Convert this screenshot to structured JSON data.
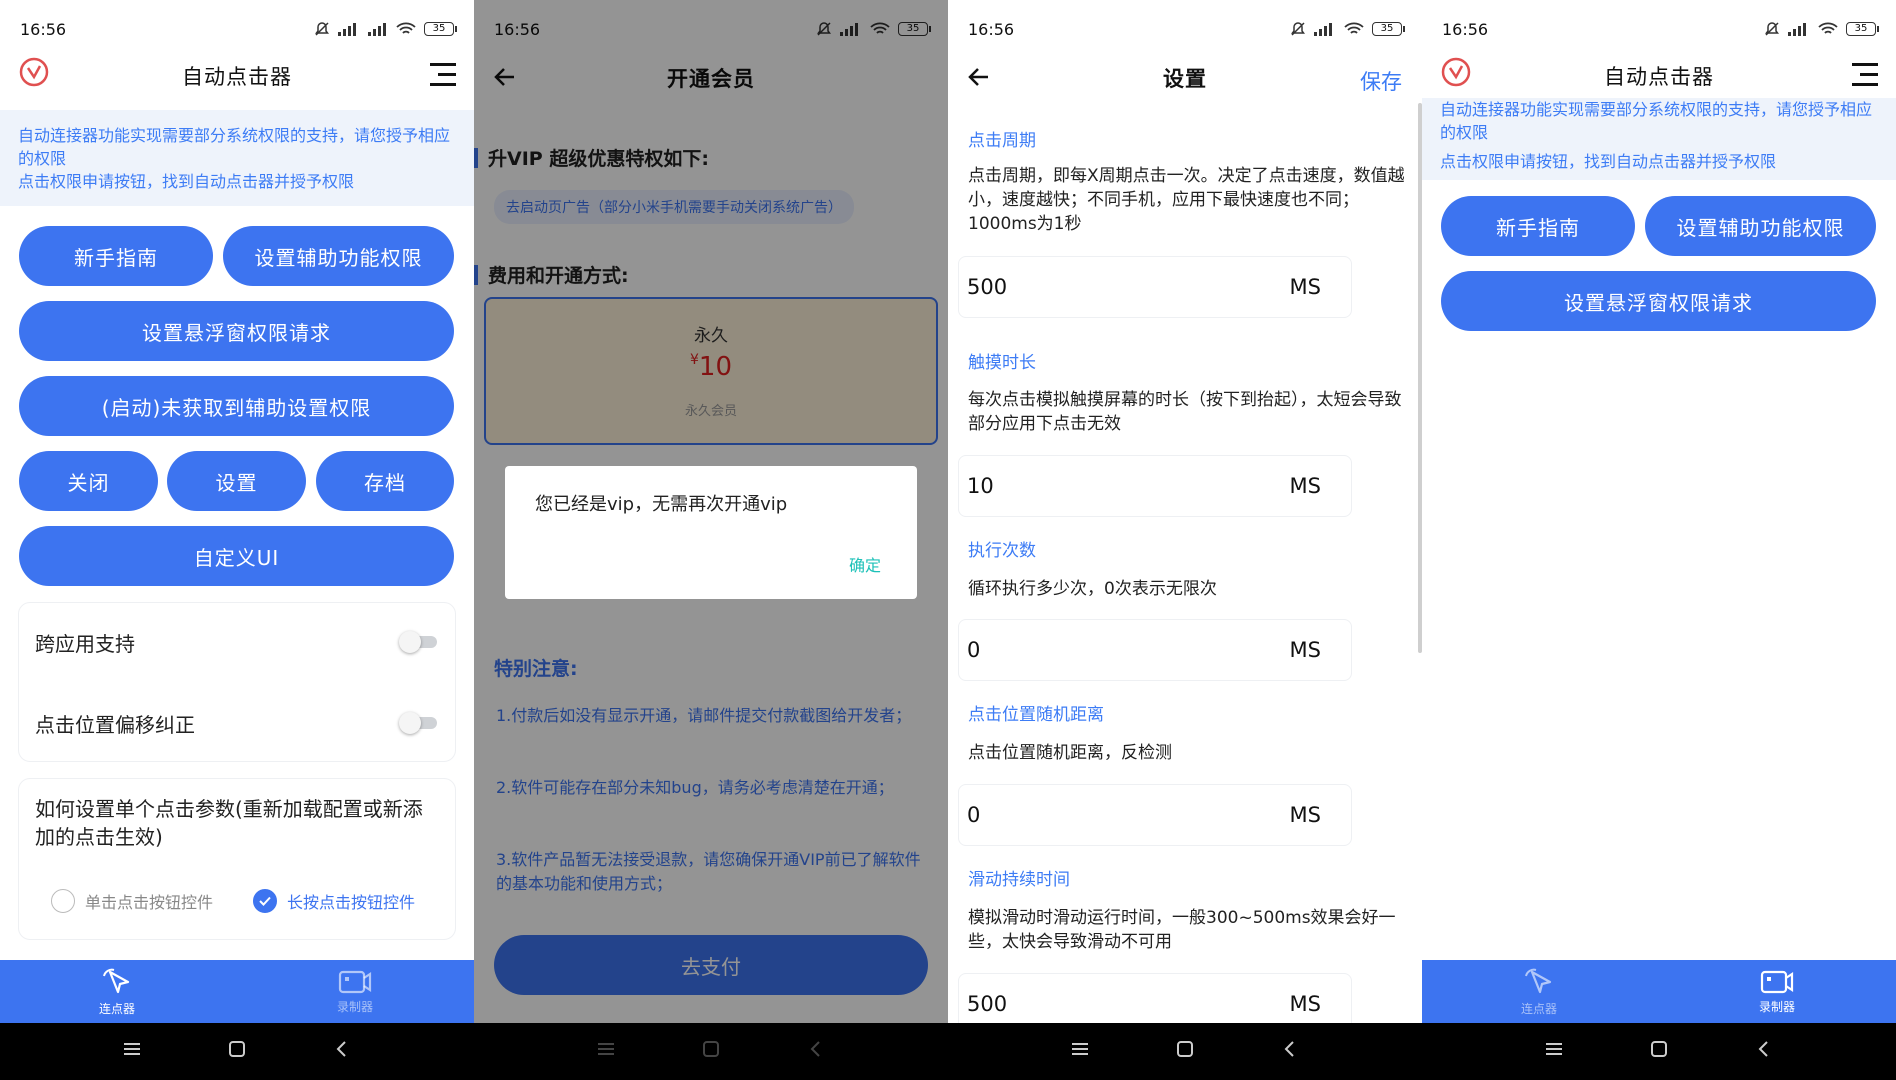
{
  "status": {
    "time": "16:56",
    "battery": "35"
  },
  "main": {
    "title": "自动点击器",
    "notice_line1": "自动连接器功能实现需要部分系统权限的支持，请您授予相应的权限",
    "notice_line2": "点击权限申请按钮，找到自动点击器并授予权限",
    "btn_guide": "新手指南",
    "btn_accessibility": "设置辅助功能权限",
    "btn_float": "设置悬浮窗权限请求",
    "btn_start": "(启动)未获取到辅助设置权限",
    "btn_close": "关闭",
    "btn_settings": "设置",
    "btn_archive": "存档",
    "btn_custom_ui": "自定义UI",
    "toggle_cross_app": {
      "label": "跨应用支持",
      "on": false
    },
    "toggle_offset": {
      "label": "点击位置偏移纠正",
      "on": false
    },
    "param_question": "如何设置单个点击参数(重新加载配置或新添加的点击生效)",
    "radio_single": {
      "label": "单击点击按钮控件",
      "checked": false
    },
    "radio_long": {
      "label": "长按点击按钮控件",
      "checked": true
    }
  },
  "tabs": {
    "clicker": "连点器",
    "recorder": "录制器"
  },
  "vip": {
    "title": "开通会员",
    "section1": "升VIP 超级优惠特权如下:",
    "chip": "去启动页广告（部分小米手机需要手动关闭系统广告）",
    "section2": "费用和开通方式:",
    "plan_name": "永久",
    "currency": "¥",
    "price": "10",
    "plan_desc": "永久会员",
    "notes_title": "特别注意:",
    "note1": "1.付款后如没有显示开通，请邮件提交付款截图给开发者；",
    "note2": "2.软件可能存在部分未知bug，请务必考虑清楚在开通；",
    "note3": "3.软件产品暂无法接受退款，请您确保开通VIP前已了解软件的基本功能和使用方式；",
    "pay_button": "去支付",
    "dialog_message": "您已经是vip，无需再次开通vip",
    "dialog_confirm": "确定"
  },
  "settings": {
    "title": "设置",
    "save": "保存",
    "unit": "MS",
    "click_period": {
      "label": "点击周期",
      "desc": "点击周期，即每X周期点击一次。决定了点击速度，数值越小，速度越快；不同手机，应用下最快速度也不同；1000ms为1秒",
      "value": "500"
    },
    "touch_duration": {
      "label": "触摸时长",
      "desc": "每次点击模拟触摸屏幕的时长（按下到抬起），太短会导致部分应用下点击无效",
      "value": "10"
    },
    "exec_count": {
      "label": "执行次数",
      "desc": "循环执行多少次，0次表示无限次",
      "value": "0"
    },
    "random_distance": {
      "label": "点击位置随机距离",
      "desc": "点击位置随机距离，反检测",
      "value": "0"
    },
    "swipe_duration": {
      "label": "滑动持续时间",
      "desc": "模拟滑动时滑动运行时间，一般300~500ms效果会好一些，太快会导致滑动不可用",
      "value": "500"
    }
  }
}
